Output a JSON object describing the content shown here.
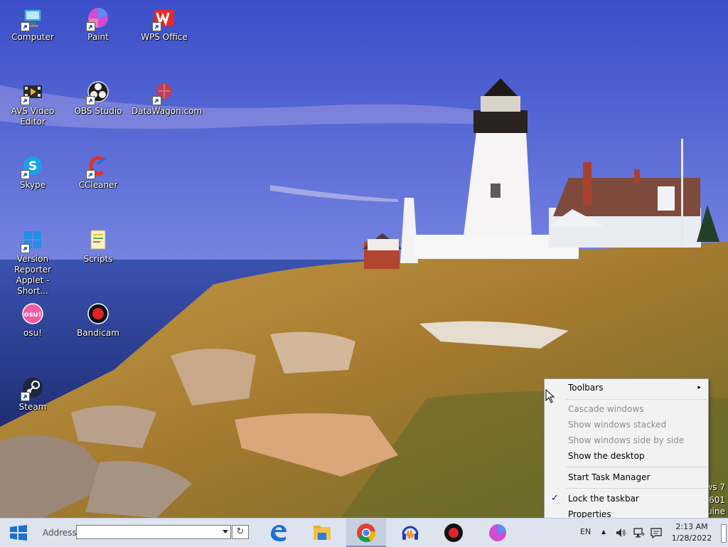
{
  "desktop": {
    "icons": [
      {
        "label": "Computer"
      },
      {
        "label": "Paint"
      },
      {
        "label": "WPS Office"
      },
      {
        "label": "AVS Video Editor"
      },
      {
        "label": "OBS Studio"
      },
      {
        "label": "DataWagon.com"
      },
      {
        "label": "Skype"
      },
      {
        "label": "CCleaner"
      },
      {
        "label": "Version Reporter Applet - Short..."
      },
      {
        "label": "Scripts"
      },
      {
        "label": "osu!"
      },
      {
        "label": "Bandicam"
      },
      {
        "label": "Steam"
      }
    ],
    "watermark": {
      "line1": "ws 7",
      "line2": "7601",
      "line3": "uine"
    }
  },
  "context_menu": {
    "items": [
      {
        "label": "Toolbars"
      },
      {
        "label": "Cascade windows"
      },
      {
        "label": "Show windows stacked"
      },
      {
        "label": "Show windows side by side"
      },
      {
        "label": "Show the desktop"
      },
      {
        "label": "Start Task Manager"
      },
      {
        "label": "Lock the taskbar"
      },
      {
        "label": "Properties"
      }
    ],
    "submenu_arrow": "▸",
    "check_mark": "✓"
  },
  "taskbar": {
    "address_label": "Address",
    "address_value": "",
    "go_glyph": "↻",
    "pinned": [
      "edge-icon",
      "file-explorer-icon",
      "chrome-icon",
      "audacity-icon",
      "bandicam-icon",
      "paint-icon"
    ],
    "tray": {
      "language": "EN",
      "up_arrow": "▲",
      "time": "2:13 AM",
      "date": "1/28/2022"
    }
  },
  "colors": {
    "sky_top": "#3a4ec8",
    "sky_bottom": "#a9a6e8",
    "sea": "#243a8c",
    "grass": "#b58a3b",
    "taskbar": "#dde4ee",
    "menu_bg": "#f2f2f2",
    "menu_disabled_text": "#8d8d8d"
  }
}
